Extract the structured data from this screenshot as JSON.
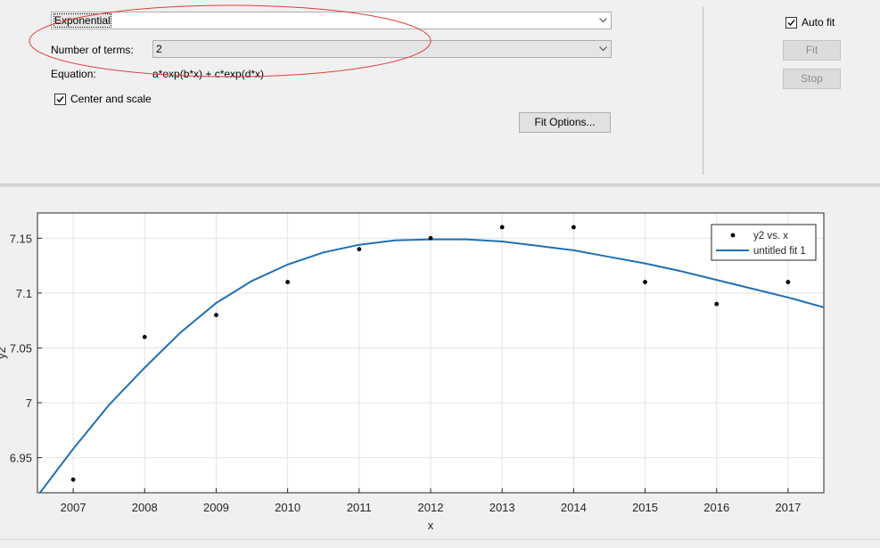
{
  "fit_type": {
    "selected": "Exponential"
  },
  "terms": {
    "label": "Number of terms:",
    "selected": "2"
  },
  "equation": {
    "label": "Equation:",
    "value": "a*exp(b*x) + c*exp(d*x)"
  },
  "center_scale": {
    "label": "Center and scale",
    "checked": true
  },
  "fit_options_button": "Fit Options...",
  "auto_fit": {
    "label": "Auto fit",
    "checked": true
  },
  "fit_button": "Fit",
  "stop_button": "Stop",
  "colors": {
    "fit_line": "#1f6fb5",
    "annotation": "#e33b3b",
    "points": "#000000"
  },
  "chart_data": {
    "type": "scatter",
    "title": "",
    "xlabel": "x",
    "ylabel": "y2",
    "xlim": [
      2006.5,
      2017.5
    ],
    "ylim": [
      6.918,
      7.173
    ],
    "xticks": [
      2007,
      2008,
      2009,
      2010,
      2011,
      2012,
      2013,
      2014,
      2015,
      2016,
      2017
    ],
    "yticks": [
      6.95,
      7,
      7.05,
      7.1,
      7.15
    ],
    "ytick_labels": [
      "6.95",
      "7",
      "7.05",
      "7.1",
      "7.15"
    ],
    "grid": true,
    "legend_position": "top-right",
    "series": [
      {
        "name": "y2 vs. x",
        "kind": "points",
        "x": [
          2007,
          2008,
          2009,
          2010,
          2011,
          2012,
          2013,
          2014,
          2015,
          2016,
          2017
        ],
        "y": [
          6.93,
          7.06,
          7.08,
          7.11,
          7.14,
          7.15,
          7.16,
          7.16,
          7.11,
          7.09,
          7.11
        ]
      },
      {
        "name": "untitled fit 1",
        "kind": "line",
        "x": [
          2006.5,
          2007,
          2007.5,
          2008,
          2008.5,
          2009,
          2009.5,
          2010,
          2010.5,
          2011,
          2011.5,
          2012,
          2012.5,
          2013,
          2013.5,
          2014,
          2014.5,
          2015,
          2015.5,
          2016,
          2016.5,
          2017,
          2017.5
        ],
        "y": [
          6.915,
          6.958,
          6.998,
          7.032,
          7.064,
          7.091,
          7.111,
          7.126,
          7.137,
          7.144,
          7.148,
          7.149,
          7.149,
          7.147,
          7.143,
          7.139,
          7.133,
          7.127,
          7.12,
          7.112,
          7.104,
          7.096,
          7.087
        ]
      }
    ]
  }
}
